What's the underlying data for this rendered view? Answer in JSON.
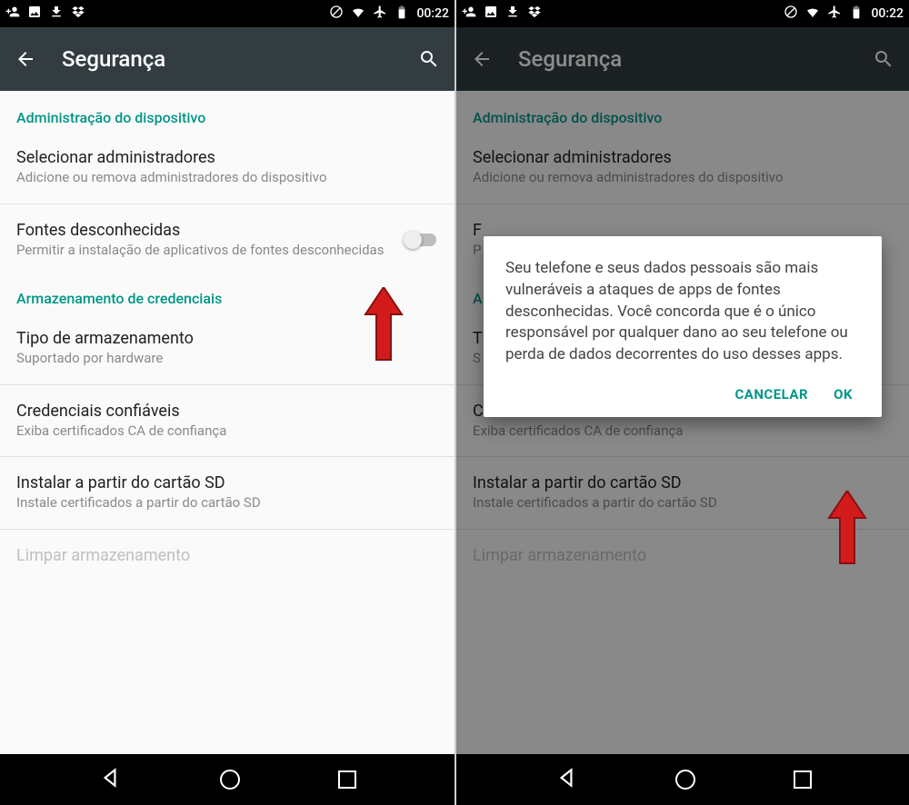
{
  "status": {
    "time": "00:22"
  },
  "appbar": {
    "title": "Segurança"
  },
  "sections": {
    "admin_header": "Administração do dispositivo",
    "cred_header": "Armazenamento de credenciais"
  },
  "items": {
    "select_admins": {
      "title": "Selecionar administradores",
      "subtitle": "Adicione ou remova administradores do dispositivo"
    },
    "unknown_sources": {
      "title": "Fontes desconhecidas",
      "subtitle": "Permitir a instalação de aplicativos de fontes desconhecidas"
    },
    "storage_type": {
      "title": "Tipo de armazenamento",
      "subtitle": "Suportado por hardware"
    },
    "trusted_creds": {
      "title": "Credenciais confiáveis",
      "subtitle": "Exiba certificados CA de confiança"
    },
    "install_sd": {
      "title": "Instalar a partir do cartão SD",
      "subtitle": "Instale certificados a partir do cartão SD"
    },
    "clear_storage": {
      "title": "Limpar armazenamento",
      "subtitle": ""
    }
  },
  "dialog": {
    "body": "Seu telefone e seus dados pessoais são mais vulneráveis a ataques de apps de fontes desconhecidas. Você concorda que é o único responsável por qualquer dano ao seu telefone ou perda de dados decorrentes do uso desses apps.",
    "cancel": "CANCELAR",
    "ok": "OK"
  },
  "right_visible": {
    "unknown_title_initial": "F",
    "unknown_subtitle_initial": "P",
    "cred_header_initial": "A",
    "storage_title_initial": "T",
    "storage_subtitle_initial": "S"
  }
}
